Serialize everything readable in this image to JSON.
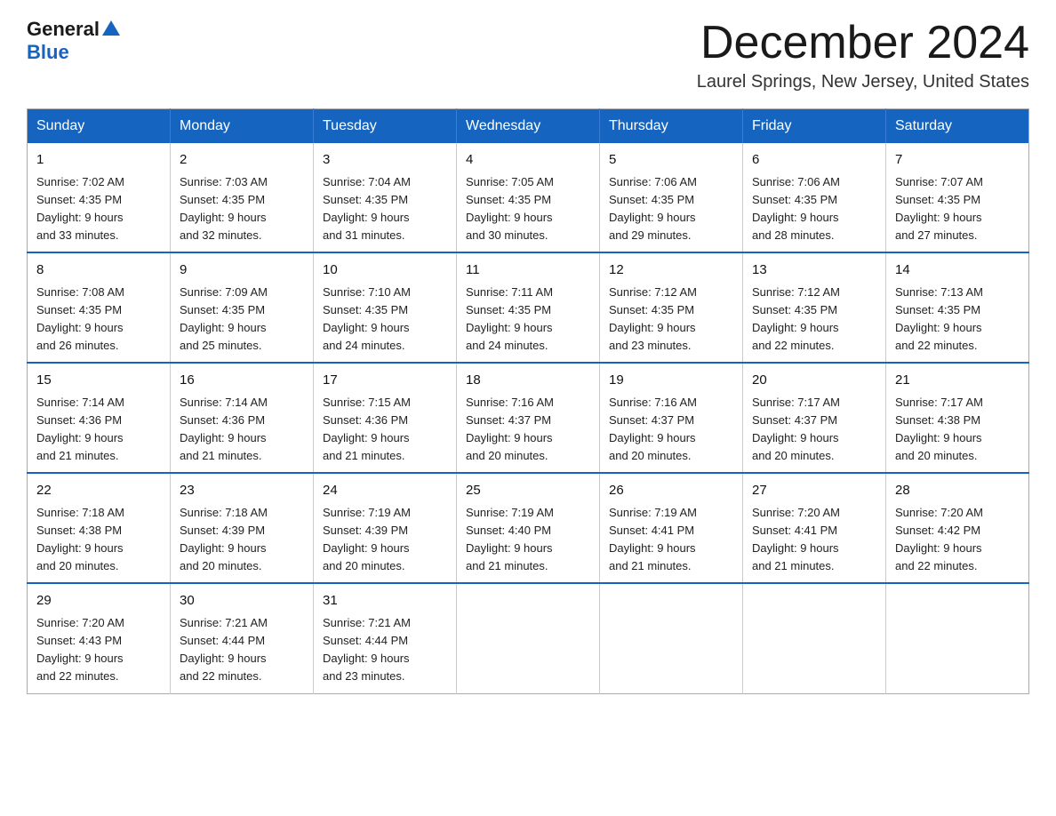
{
  "header": {
    "logo_general": "General",
    "logo_blue": "Blue",
    "month_title": "December 2024",
    "location": "Laurel Springs, New Jersey, United States"
  },
  "weekdays": [
    "Sunday",
    "Monday",
    "Tuesday",
    "Wednesday",
    "Thursday",
    "Friday",
    "Saturday"
  ],
  "weeks": [
    [
      {
        "day": "1",
        "sunrise": "Sunrise: 7:02 AM",
        "sunset": "Sunset: 4:35 PM",
        "daylight": "Daylight: 9 hours",
        "minutes": "and 33 minutes."
      },
      {
        "day": "2",
        "sunrise": "Sunrise: 7:03 AM",
        "sunset": "Sunset: 4:35 PM",
        "daylight": "Daylight: 9 hours",
        "minutes": "and 32 minutes."
      },
      {
        "day": "3",
        "sunrise": "Sunrise: 7:04 AM",
        "sunset": "Sunset: 4:35 PM",
        "daylight": "Daylight: 9 hours",
        "minutes": "and 31 minutes."
      },
      {
        "day": "4",
        "sunrise": "Sunrise: 7:05 AM",
        "sunset": "Sunset: 4:35 PM",
        "daylight": "Daylight: 9 hours",
        "minutes": "and 30 minutes."
      },
      {
        "day": "5",
        "sunrise": "Sunrise: 7:06 AM",
        "sunset": "Sunset: 4:35 PM",
        "daylight": "Daylight: 9 hours",
        "minutes": "and 29 minutes."
      },
      {
        "day": "6",
        "sunrise": "Sunrise: 7:06 AM",
        "sunset": "Sunset: 4:35 PM",
        "daylight": "Daylight: 9 hours",
        "minutes": "and 28 minutes."
      },
      {
        "day": "7",
        "sunrise": "Sunrise: 7:07 AM",
        "sunset": "Sunset: 4:35 PM",
        "daylight": "Daylight: 9 hours",
        "minutes": "and 27 minutes."
      }
    ],
    [
      {
        "day": "8",
        "sunrise": "Sunrise: 7:08 AM",
        "sunset": "Sunset: 4:35 PM",
        "daylight": "Daylight: 9 hours",
        "minutes": "and 26 minutes."
      },
      {
        "day": "9",
        "sunrise": "Sunrise: 7:09 AM",
        "sunset": "Sunset: 4:35 PM",
        "daylight": "Daylight: 9 hours",
        "minutes": "and 25 minutes."
      },
      {
        "day": "10",
        "sunrise": "Sunrise: 7:10 AM",
        "sunset": "Sunset: 4:35 PM",
        "daylight": "Daylight: 9 hours",
        "minutes": "and 24 minutes."
      },
      {
        "day": "11",
        "sunrise": "Sunrise: 7:11 AM",
        "sunset": "Sunset: 4:35 PM",
        "daylight": "Daylight: 9 hours",
        "minutes": "and 24 minutes."
      },
      {
        "day": "12",
        "sunrise": "Sunrise: 7:12 AM",
        "sunset": "Sunset: 4:35 PM",
        "daylight": "Daylight: 9 hours",
        "minutes": "and 23 minutes."
      },
      {
        "day": "13",
        "sunrise": "Sunrise: 7:12 AM",
        "sunset": "Sunset: 4:35 PM",
        "daylight": "Daylight: 9 hours",
        "minutes": "and 22 minutes."
      },
      {
        "day": "14",
        "sunrise": "Sunrise: 7:13 AM",
        "sunset": "Sunset: 4:35 PM",
        "daylight": "Daylight: 9 hours",
        "minutes": "and 22 minutes."
      }
    ],
    [
      {
        "day": "15",
        "sunrise": "Sunrise: 7:14 AM",
        "sunset": "Sunset: 4:36 PM",
        "daylight": "Daylight: 9 hours",
        "minutes": "and 21 minutes."
      },
      {
        "day": "16",
        "sunrise": "Sunrise: 7:14 AM",
        "sunset": "Sunset: 4:36 PM",
        "daylight": "Daylight: 9 hours",
        "minutes": "and 21 minutes."
      },
      {
        "day": "17",
        "sunrise": "Sunrise: 7:15 AM",
        "sunset": "Sunset: 4:36 PM",
        "daylight": "Daylight: 9 hours",
        "minutes": "and 21 minutes."
      },
      {
        "day": "18",
        "sunrise": "Sunrise: 7:16 AM",
        "sunset": "Sunset: 4:37 PM",
        "daylight": "Daylight: 9 hours",
        "minutes": "and 20 minutes."
      },
      {
        "day": "19",
        "sunrise": "Sunrise: 7:16 AM",
        "sunset": "Sunset: 4:37 PM",
        "daylight": "Daylight: 9 hours",
        "minutes": "and 20 minutes."
      },
      {
        "day": "20",
        "sunrise": "Sunrise: 7:17 AM",
        "sunset": "Sunset: 4:37 PM",
        "daylight": "Daylight: 9 hours",
        "minutes": "and 20 minutes."
      },
      {
        "day": "21",
        "sunrise": "Sunrise: 7:17 AM",
        "sunset": "Sunset: 4:38 PM",
        "daylight": "Daylight: 9 hours",
        "minutes": "and 20 minutes."
      }
    ],
    [
      {
        "day": "22",
        "sunrise": "Sunrise: 7:18 AM",
        "sunset": "Sunset: 4:38 PM",
        "daylight": "Daylight: 9 hours",
        "minutes": "and 20 minutes."
      },
      {
        "day": "23",
        "sunrise": "Sunrise: 7:18 AM",
        "sunset": "Sunset: 4:39 PM",
        "daylight": "Daylight: 9 hours",
        "minutes": "and 20 minutes."
      },
      {
        "day": "24",
        "sunrise": "Sunrise: 7:19 AM",
        "sunset": "Sunset: 4:39 PM",
        "daylight": "Daylight: 9 hours",
        "minutes": "and 20 minutes."
      },
      {
        "day": "25",
        "sunrise": "Sunrise: 7:19 AM",
        "sunset": "Sunset: 4:40 PM",
        "daylight": "Daylight: 9 hours",
        "minutes": "and 21 minutes."
      },
      {
        "day": "26",
        "sunrise": "Sunrise: 7:19 AM",
        "sunset": "Sunset: 4:41 PM",
        "daylight": "Daylight: 9 hours",
        "minutes": "and 21 minutes."
      },
      {
        "day": "27",
        "sunrise": "Sunrise: 7:20 AM",
        "sunset": "Sunset: 4:41 PM",
        "daylight": "Daylight: 9 hours",
        "minutes": "and 21 minutes."
      },
      {
        "day": "28",
        "sunrise": "Sunrise: 7:20 AM",
        "sunset": "Sunset: 4:42 PM",
        "daylight": "Daylight: 9 hours",
        "minutes": "and 22 minutes."
      }
    ],
    [
      {
        "day": "29",
        "sunrise": "Sunrise: 7:20 AM",
        "sunset": "Sunset: 4:43 PM",
        "daylight": "Daylight: 9 hours",
        "minutes": "and 22 minutes."
      },
      {
        "day": "30",
        "sunrise": "Sunrise: 7:21 AM",
        "sunset": "Sunset: 4:44 PM",
        "daylight": "Daylight: 9 hours",
        "minutes": "and 22 minutes."
      },
      {
        "day": "31",
        "sunrise": "Sunrise: 7:21 AM",
        "sunset": "Sunset: 4:44 PM",
        "daylight": "Daylight: 9 hours",
        "minutes": "and 23 minutes."
      },
      {
        "day": "",
        "sunrise": "",
        "sunset": "",
        "daylight": "",
        "minutes": ""
      },
      {
        "day": "",
        "sunrise": "",
        "sunset": "",
        "daylight": "",
        "minutes": ""
      },
      {
        "day": "",
        "sunrise": "",
        "sunset": "",
        "daylight": "",
        "minutes": ""
      },
      {
        "day": "",
        "sunrise": "",
        "sunset": "",
        "daylight": "",
        "minutes": ""
      }
    ]
  ]
}
